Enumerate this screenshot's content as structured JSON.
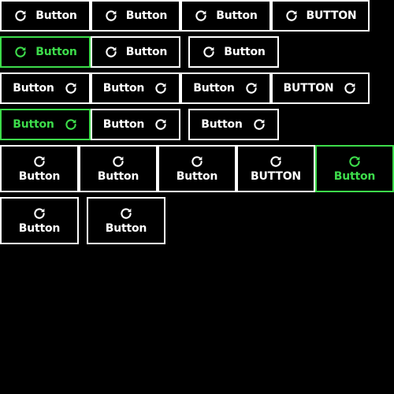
{
  "colors": {
    "background": "#000000",
    "border": "#ffffff",
    "text": "#ffffff",
    "active": "#3ddc4b"
  },
  "icon": "refresh-icon",
  "groups": {
    "icon_left": {
      "row1": [
        "Button",
        "Button",
        "Button",
        "BUTTON"
      ],
      "row2": [
        "Button",
        "Button",
        "Button"
      ]
    },
    "icon_right": {
      "row1": [
        "Button",
        "Button",
        "Button",
        "BUTTON"
      ],
      "row2": [
        "Button",
        "Button",
        "Button"
      ]
    },
    "icon_top": {
      "row1": [
        "Button",
        "Button",
        "Button",
        "BUTTON",
        "Button"
      ],
      "row2": [
        "Button",
        "Button"
      ]
    }
  }
}
